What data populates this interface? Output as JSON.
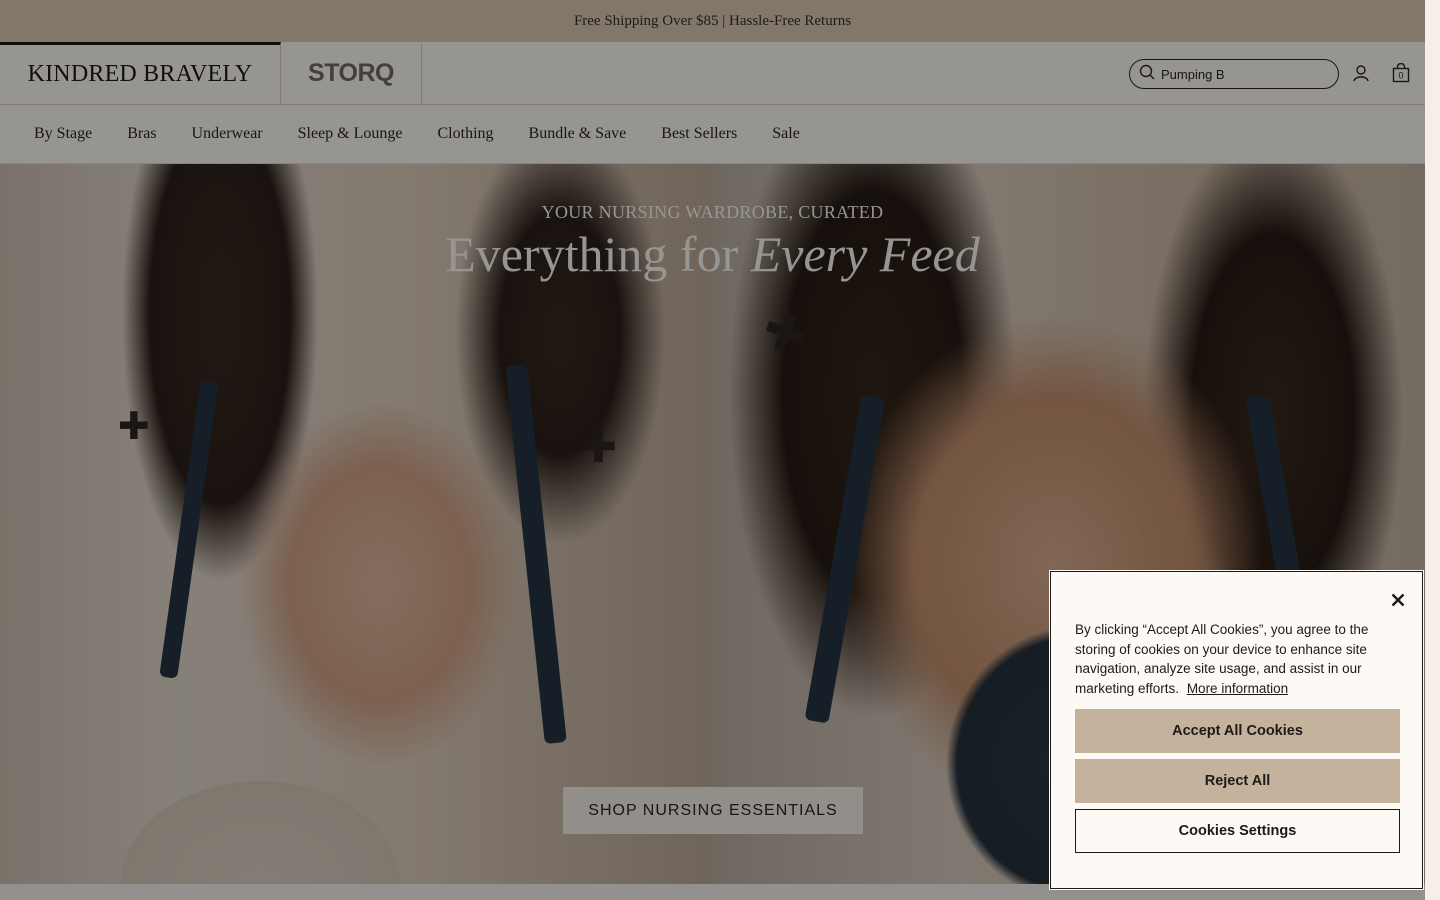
{
  "announcement": {
    "text": "Free Shipping Over $85 | Hassle-Free Returns"
  },
  "header": {
    "brands": [
      "KINDRED BRAVELY",
      "STORQ"
    ],
    "search": {
      "value": "Pumping B",
      "icon": "search-icon"
    },
    "account_icon": "user-icon",
    "cart": {
      "icon": "shopping-bag-icon",
      "count": "0"
    }
  },
  "nav": {
    "items": [
      "By Stage",
      "Bras",
      "Underwear",
      "Sleep & Lounge",
      "Clothing",
      "Bundle & Save",
      "Best Sellers",
      "Sale"
    ]
  },
  "hero": {
    "eyebrow": "YOUR NURSING WARDROBE, CURATED",
    "title_plain": "Everything for",
    "title_italic": "Every Feed",
    "cta": "SHOP NURSING ESSENTIALS"
  },
  "cookie_banner": {
    "text": "By clicking “Accept All Cookies”, you agree to the storing of cookies on your device to enhance site navigation, analyze site usage, and assist in our marketing efforts.",
    "link": "More information",
    "accept": "Accept All Cookies",
    "reject": "Reject All",
    "settings": "Cookies Settings",
    "close_icon": "close-icon"
  },
  "colors": {
    "announcement_bg": "#d7c8b3",
    "button_bg": "#c4b29d",
    "page_bg": "#f6f2ec"
  }
}
